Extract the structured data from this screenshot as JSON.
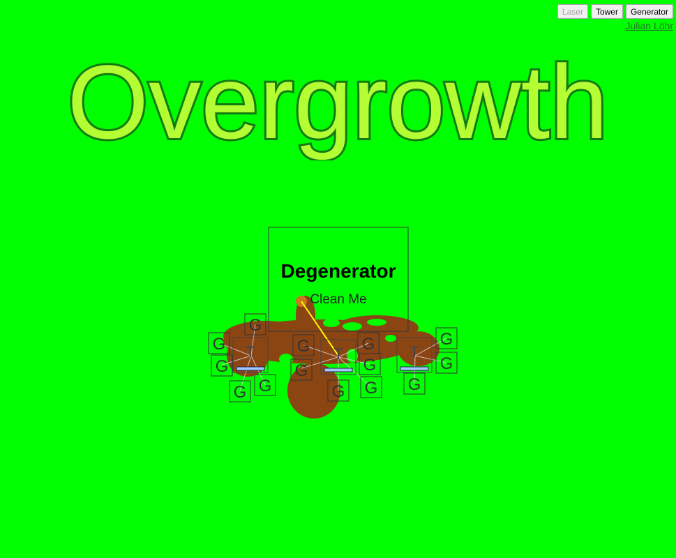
{
  "toolbar": {
    "laser": "Laser",
    "tower": "Tower",
    "generator": "Generator"
  },
  "credit": "Julian Löhr",
  "title": "Overgrowth",
  "degenerator": {
    "title": "Degenerator",
    "subtitle": "Clean Me"
  },
  "colors": {
    "background": "#00ff00",
    "title_fill": "#b3ff33",
    "title_stroke": "#137a13",
    "blight": "#8b4513",
    "laser_beam": "#ffff00",
    "tower_bar": "#a0c8ff"
  }
}
